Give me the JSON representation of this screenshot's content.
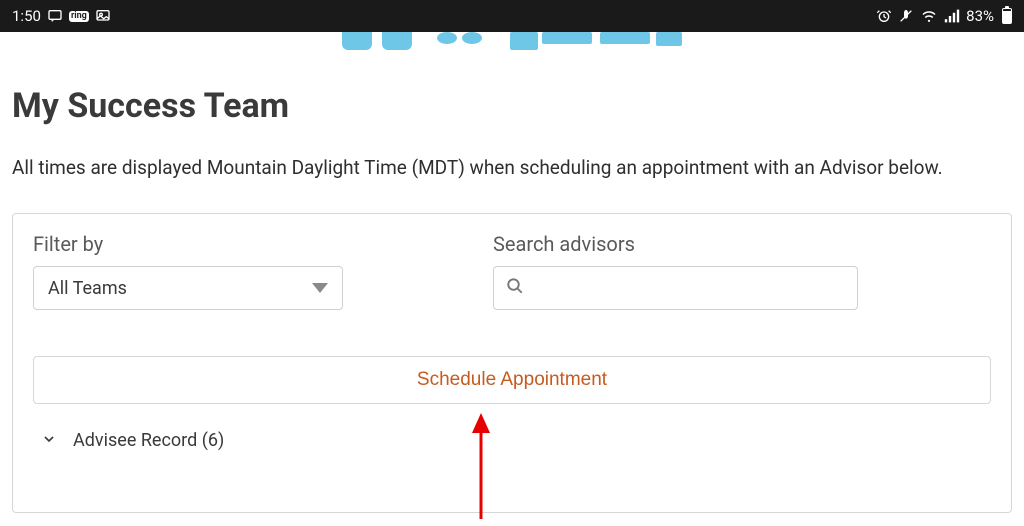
{
  "status_bar": {
    "time": "1:50",
    "battery_pct": "83%"
  },
  "page": {
    "title": "My Success Team",
    "timezone_note": "All times are displayed Mountain Daylight Time (MDT) when scheduling an appointment with an Advisor below."
  },
  "filters": {
    "filter_by_label": "Filter by",
    "filter_by_value": "All Teams",
    "search_label": "Search advisors",
    "search_placeholder": ""
  },
  "actions": {
    "schedule_label": "Schedule Appointment"
  },
  "accordion": {
    "advisee_record_label": "Advisee Record (6)"
  }
}
